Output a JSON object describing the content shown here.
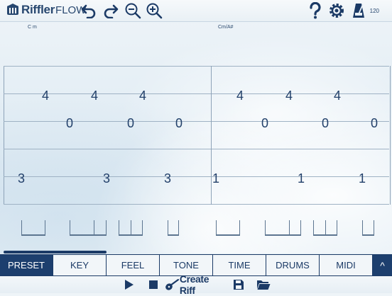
{
  "header": {
    "brand": "Riffler",
    "brand_suffix": "FLOW",
    "tempo": "120",
    "icons": [
      "logo-icon",
      "undo-icon",
      "redo-icon",
      "zoom-out-icon",
      "zoom-in-icon",
      "help-icon",
      "gear-icon",
      "metronome-icon"
    ]
  },
  "chords": [
    {
      "name": "C m"
    },
    {
      "name": "Cm/A#"
    }
  ],
  "tab": {
    "notes": [
      {
        "fret": "4",
        "string": 2
      },
      {
        "fret": "4",
        "string": 2
      },
      {
        "fret": "4",
        "string": 2
      },
      {
        "fret": "0",
        "string": 3
      },
      {
        "fret": "0",
        "string": 3
      },
      {
        "fret": "0",
        "string": 3
      },
      {
        "fret": "3",
        "string": 5
      },
      {
        "fret": "3",
        "string": 5
      },
      {
        "fret": "3",
        "string": 5
      },
      {
        "fret": "4",
        "string": 2
      },
      {
        "fret": "4",
        "string": 2
      },
      {
        "fret": "4",
        "string": 2
      },
      {
        "fret": "0",
        "string": 3
      },
      {
        "fret": "0",
        "string": 3
      },
      {
        "fret": "0",
        "string": 3
      },
      {
        "fret": "1",
        "string": 5
      },
      {
        "fret": "1",
        "string": 5
      },
      {
        "fret": "1",
        "string": 5
      }
    ]
  },
  "tabs": [
    {
      "label": "PRESET",
      "active": true
    },
    {
      "label": "KEY"
    },
    {
      "label": "FEEL"
    },
    {
      "label": "TONE"
    },
    {
      "label": "TIME"
    },
    {
      "label": "DRUMS"
    },
    {
      "label": "MIDI"
    }
  ],
  "tabs_toggle": "^",
  "bottom": {
    "create_label": "Create Riff",
    "icons": [
      "play-icon",
      "stop-icon",
      "guitar-icon",
      "save-icon",
      "folder-icon"
    ]
  },
  "colors": {
    "accent": "#1d3f6e",
    "text": "#1e3a63",
    "background": "#e4eef5"
  }
}
